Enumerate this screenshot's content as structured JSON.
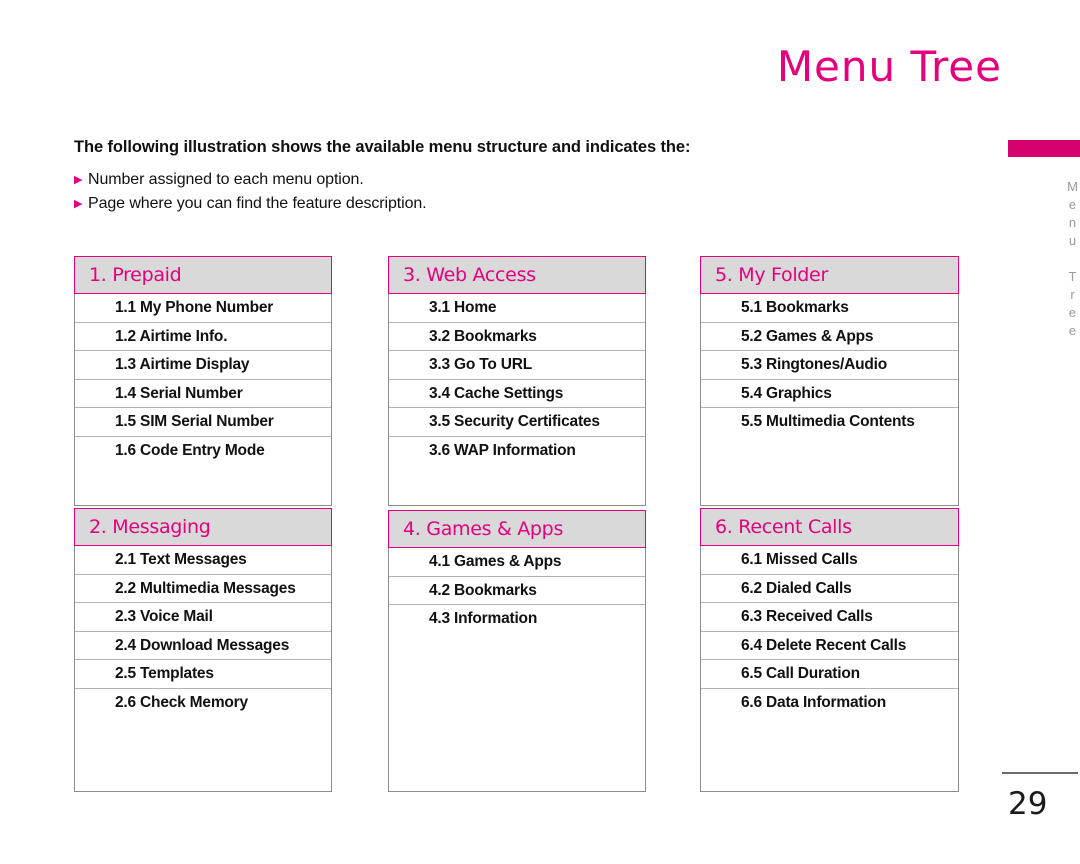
{
  "page": {
    "title": "Menu Tree",
    "number": "29"
  },
  "intro": {
    "heading": "The following illustration shows the available menu structure and indicates the:",
    "bullets": [
      {
        "icon": "triangle-right-bullet-icon",
        "text": "Number assigned to each menu option."
      },
      {
        "icon": "triangle-right-bullet-icon",
        "text": "Page where you can find the feature description."
      }
    ]
  },
  "sidebar": {
    "label": "Menu Tree",
    "accent_color": "#d6006e"
  },
  "colors": {
    "accent_pink": "#e5007e",
    "header_background": "#d9d9d9",
    "body_border": "#8c8c8c",
    "row_divider": "#b3b3b3",
    "text": "#111111"
  },
  "menu_tables": [
    {
      "header": "1. Prepaid",
      "column": 1,
      "position": "top",
      "items": [
        "1.1 My Phone Number",
        "1.2 Airtime Info.",
        "1.3 Airtime Display",
        "1.4 Serial Number",
        "1.5 SIM Serial Number",
        "1.6 Code Entry Mode"
      ]
    },
    {
      "header": "2. Messaging",
      "column": 1,
      "position": "bottom",
      "items": [
        "2.1 Text Messages",
        "2.2 Multimedia Messages",
        "2.3 Voice Mail",
        "2.4 Download Messages",
        "2.5 Templates",
        "2.6 Check Memory"
      ]
    },
    {
      "header": "3. Web Access",
      "column": 2,
      "position": "top",
      "items": [
        "3.1 Home",
        "3.2 Bookmarks",
        "3.3 Go To URL",
        "3.4 Cache Settings",
        "3.5 Security Certificates",
        "3.6 WAP Information"
      ]
    },
    {
      "header": "4. Games & Apps",
      "column": 2,
      "position": "bottom",
      "items": [
        "4.1 Games & Apps",
        "4.2 Bookmarks",
        "4.3 Information"
      ]
    },
    {
      "header": "5. My Folder",
      "column": 3,
      "position": "top",
      "items": [
        "5.1 Bookmarks",
        "5.2 Games & Apps",
        "5.3 Ringtones/Audio",
        "5.4 Graphics",
        "5.5 Multimedia Contents"
      ]
    },
    {
      "header": "6. Recent Calls",
      "column": 3,
      "position": "bottom",
      "items": [
        "6.1 Missed Calls",
        "6.2 Dialed Calls",
        "6.3 Received Calls",
        "6.4 Delete Recent Calls",
        "6.5 Call Duration",
        "6.6 Data Information"
      ]
    }
  ]
}
